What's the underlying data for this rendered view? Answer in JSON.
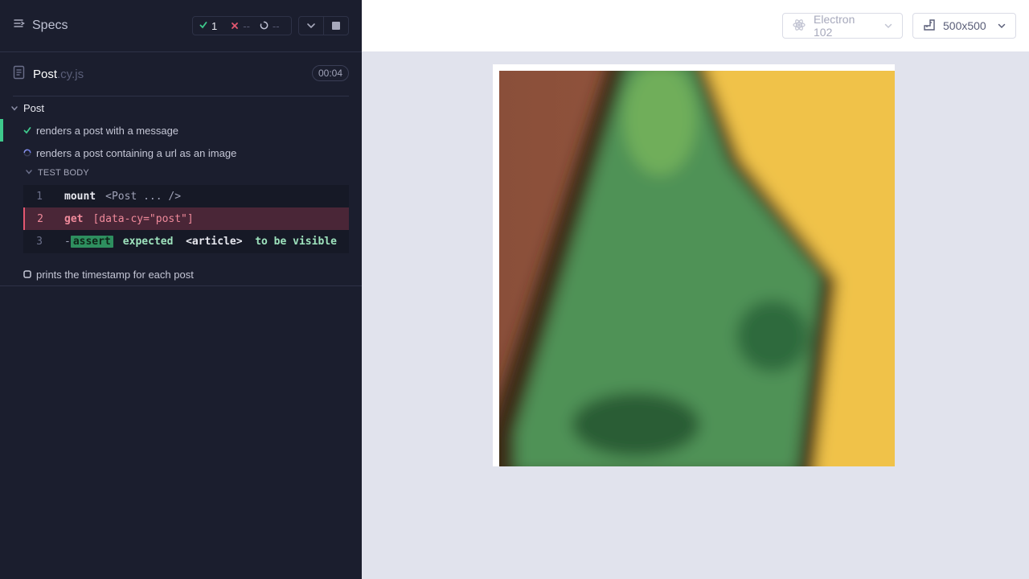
{
  "reporter": {
    "header": {
      "specs_label": "Specs",
      "stats": {
        "passed": "1",
        "failed": "--",
        "pending": "--"
      }
    },
    "spec": {
      "name": "Post",
      "extension": ".cy.js",
      "duration": "00:04"
    },
    "suite": {
      "title": "Post",
      "tests": [
        {
          "title": "renders a post with a message",
          "state": "passed"
        },
        {
          "title": "renders a post containing a url as an image",
          "state": "running"
        },
        {
          "title": "prints the timestamp for each post",
          "state": "pending"
        }
      ]
    },
    "test_body_label": "TEST BODY",
    "commands": [
      {
        "number": "1",
        "name": "mount",
        "message": "<Post ... />"
      },
      {
        "number": "2",
        "name": "get",
        "message": "[data-cy=\"post\"]"
      },
      {
        "number": "3",
        "dash": "-",
        "badge": "assert",
        "pre": "expected",
        "element": "<article>",
        "post": "to be visible"
      }
    ]
  },
  "topbar": {
    "browser": "Electron 102",
    "viewport": "500x500"
  },
  "colors": {
    "reporter_bg": "#1b1e2e",
    "passed": "#3ec98c",
    "failed": "#e45770",
    "running": "#6f7de8",
    "aut_bg": "#e1e3ed"
  },
  "icons": {
    "specs": "specs-list-icon",
    "spec_file": "document-icon",
    "browser": "electron-icon",
    "viewport": "ruler-icon"
  }
}
